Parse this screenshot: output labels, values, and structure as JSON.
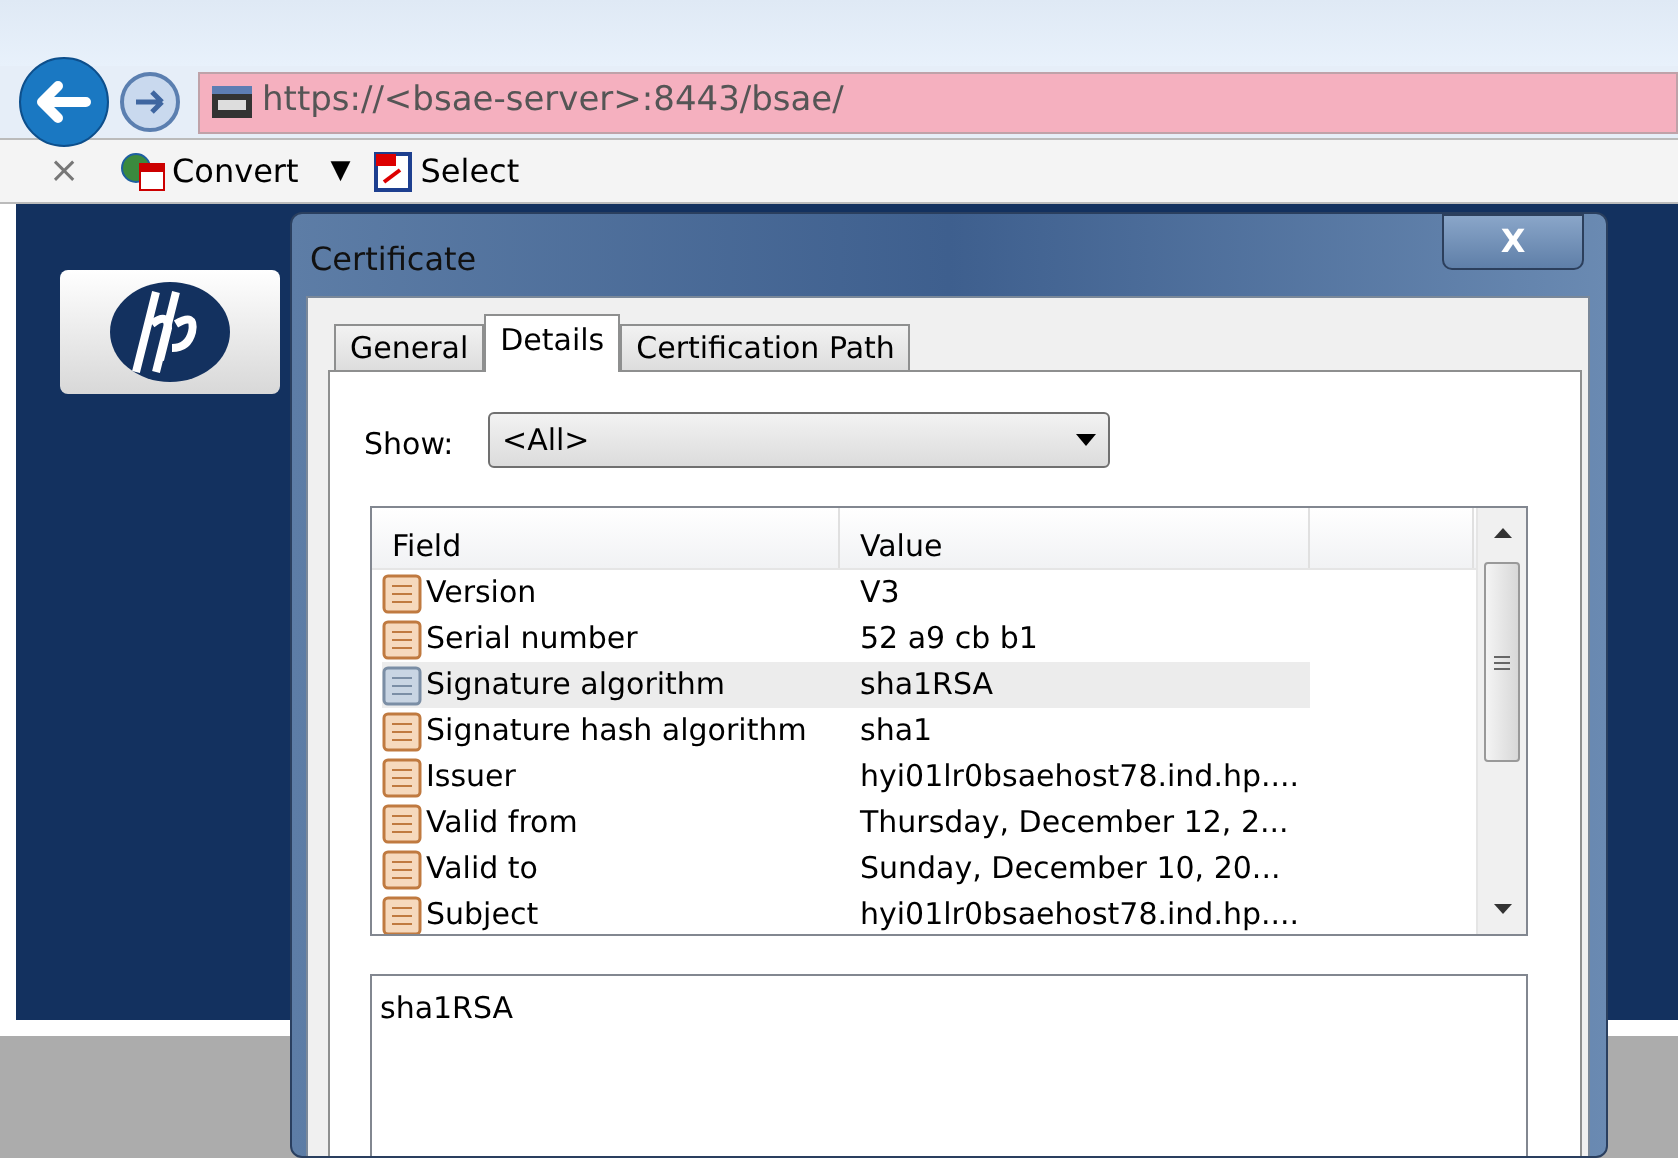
{
  "browser": {
    "address": "https://<bsae-server>:8443/bsae/",
    "toolbar": [
      {
        "kind": "close",
        "label": "×"
      },
      {
        "kind": "convert",
        "label": "Convert"
      },
      {
        "kind": "caret",
        "label": "▼"
      },
      {
        "kind": "select",
        "label": "Select"
      }
    ]
  },
  "dialog": {
    "title": "Certificate",
    "close_label": "X",
    "tabs": [
      {
        "label": "General",
        "selected": false
      },
      {
        "label": "Details",
        "selected": true
      },
      {
        "label": "Certification Path",
        "selected": false
      }
    ],
    "show": {
      "label": "Show:",
      "value": "<All>"
    },
    "table": {
      "columns": [
        "Field",
        "Value"
      ],
      "rows": [
        {
          "field": "Version",
          "value": "V3",
          "selected": false
        },
        {
          "field": "Serial number",
          "value": "52 a9 cb b1",
          "selected": false
        },
        {
          "field": "Signature algorithm",
          "value": "sha1RSA",
          "selected": true
        },
        {
          "field": "Signature hash algorithm",
          "value": "sha1",
          "selected": false
        },
        {
          "field": "Issuer",
          "value": "hyi01lr0bsaehost78.ind.hp....",
          "selected": false
        },
        {
          "field": "Valid from",
          "value": "Thursday, December 12, 2...",
          "selected": false
        },
        {
          "field": "Valid to",
          "value": "Sunday, December 10, 20...",
          "selected": false
        },
        {
          "field": "Subject",
          "value": "hyi01lr0bsaehost78.ind.hp....",
          "selected": false
        }
      ]
    },
    "detail_value": "sha1RSA"
  }
}
